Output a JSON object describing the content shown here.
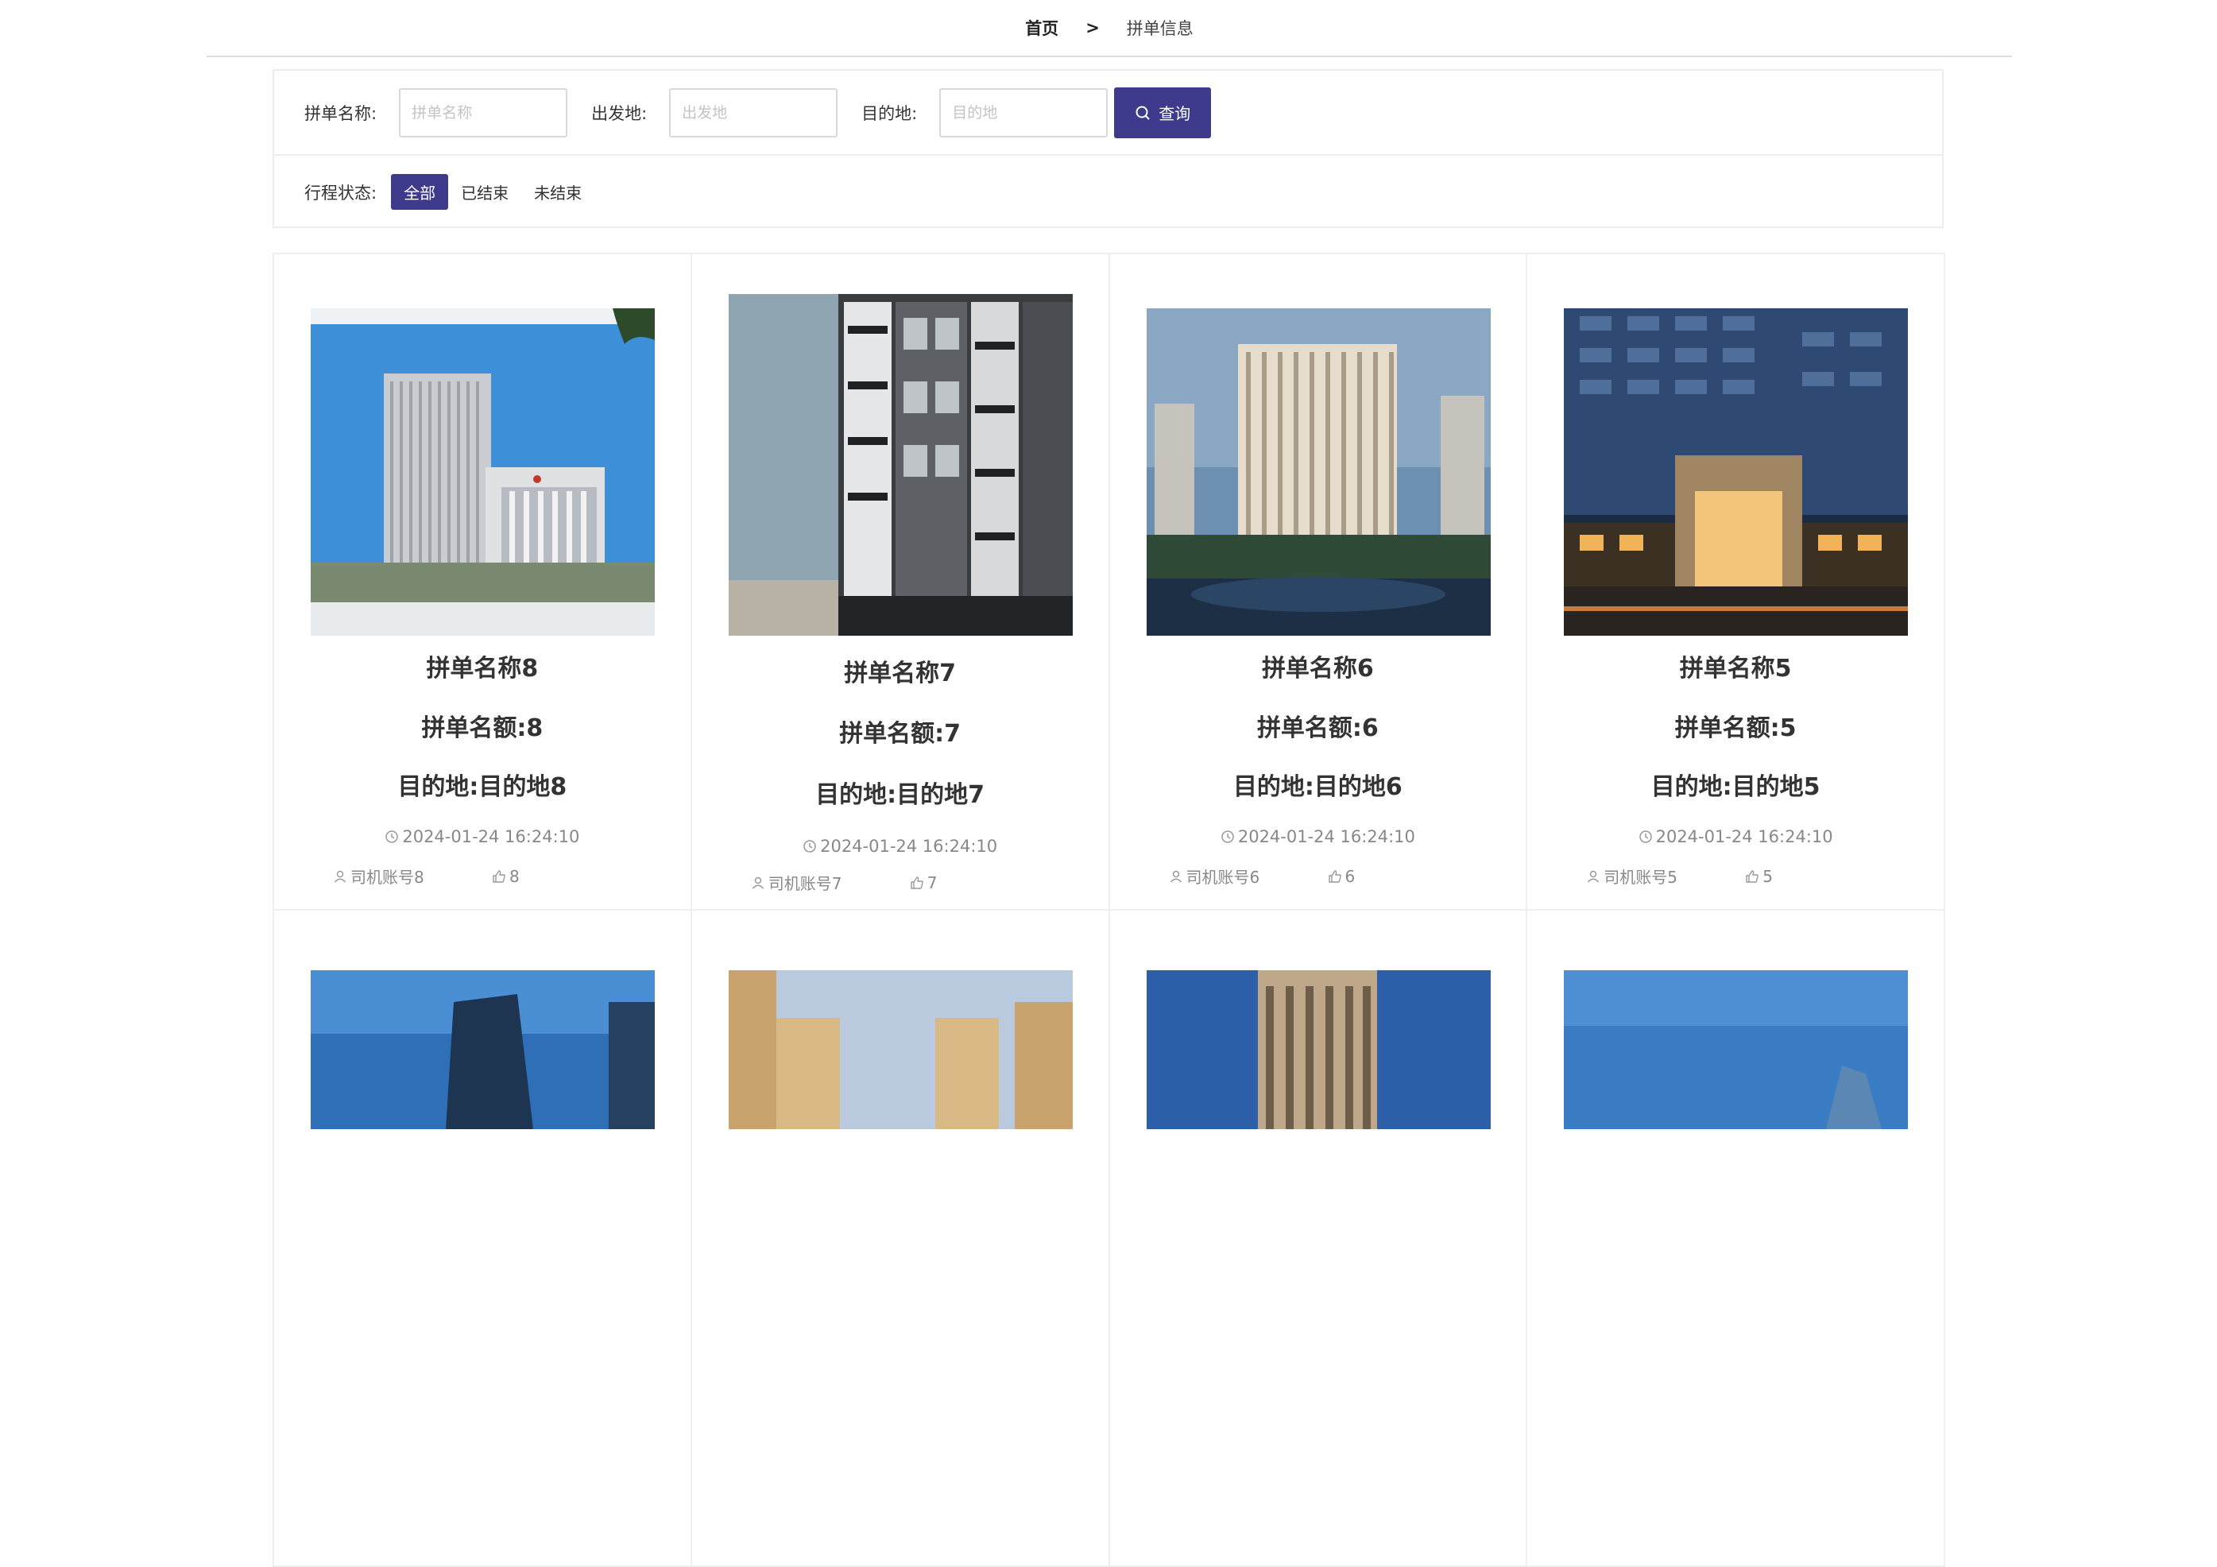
{
  "breadcrumb": {
    "home": "首页",
    "separator": ">",
    "current": "拼单信息"
  },
  "filters": {
    "name_label": "拼单名称:",
    "name_placeholder": "拼单名称",
    "origin_label": "出发地:",
    "origin_placeholder": "出发地",
    "dest_label": "目的地:",
    "dest_placeholder": "目的地",
    "search_label": "查询",
    "status_label": "行程状态:",
    "status_options": [
      "全部",
      "已结束",
      "未结束"
    ],
    "status_selected": "全部"
  },
  "accent_color": "#3e3b8c",
  "cards": [
    {
      "title": "拼单名称8",
      "seats": "拼单名额:8",
      "dest": "目的地:目的地8",
      "time": "2024-01-24 16:24:10",
      "driver": "司机账号8",
      "likes": "8"
    },
    {
      "title": "拼单名称7",
      "seats": "拼单名额:7",
      "dest": "目的地:目的地7",
      "time": "2024-01-24 16:24:10",
      "driver": "司机账号7",
      "likes": "7"
    },
    {
      "title": "拼单名称6",
      "seats": "拼单名额:6",
      "dest": "目的地:目的地6",
      "time": "2024-01-24 16:24:10",
      "driver": "司机账号6",
      "likes": "6"
    },
    {
      "title": "拼单名称5",
      "seats": "拼单名额:5",
      "dest": "目的地:目的地5",
      "time": "2024-01-24 16:24:10",
      "driver": "司机账号5",
      "likes": "5"
    }
  ],
  "icons": {
    "search": "search-icon",
    "clock": "clock-icon",
    "user": "user-icon",
    "like": "thumb-up-icon"
  }
}
